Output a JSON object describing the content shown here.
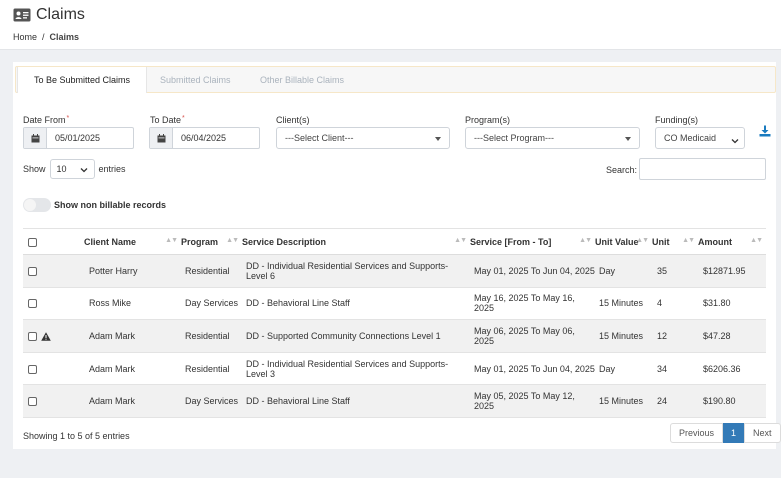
{
  "page": {
    "title": "Claims",
    "title_icon": "id-card-icon"
  },
  "breadcrumb": {
    "home": "Home",
    "separator": "/",
    "current": "Claims"
  },
  "tabs": [
    {
      "label": "To Be Submitted Claims",
      "active": true
    },
    {
      "label": "Submitted Claims",
      "active": false
    },
    {
      "label": "Other Billable Claims",
      "active": false
    }
  ],
  "filters": {
    "date_from": {
      "label": "Date From",
      "required_mark": "*",
      "value": "05/01/2025"
    },
    "to_date": {
      "label": "To Date",
      "required_mark": "*",
      "value": "06/04/2025"
    },
    "clients": {
      "label": "Client(s)",
      "value": "---Select Client---"
    },
    "programs": {
      "label": "Program(s)",
      "value": "---Select Program---"
    },
    "funding": {
      "label": "Funding(s)",
      "value": "CO Medicaid"
    },
    "download_icon": "download-icon"
  },
  "table_controls": {
    "show_label": "Show",
    "entries_value": "10",
    "entries_label": "entries",
    "search_label": "Search:",
    "search_value": "",
    "toggle_label": "Show non billable records",
    "toggle_on": false
  },
  "columns": [
    "Client Name",
    "Program",
    "Service Description",
    "Service [From - To]",
    "Unit Value",
    "Unit",
    "Amount"
  ],
  "rows": [
    {
      "client": "Potter Harry",
      "program": "Residential",
      "description": "DD - Individual Residential Services and Supports- Level 6",
      "service": "May 01, 2025 To Jun 04, 2025",
      "unit_value": "Day",
      "unit": "35",
      "amount": "$12871.95",
      "warning": false
    },
    {
      "client": "Ross Mike",
      "program": "Day Services",
      "description": "DD - Behavioral Line Staff",
      "service": "May 16, 2025 To May 16, 2025",
      "unit_value": "15 Minutes",
      "unit": "4",
      "amount": "$31.80",
      "warning": false
    },
    {
      "client": "Adam Mark",
      "program": "Residential",
      "description": "DD - Supported Community Connections Level 1",
      "service": "May 06, 2025 To May 06, 2025",
      "unit_value": "15 Minutes",
      "unit": "12",
      "amount": "$47.28",
      "warning": true
    },
    {
      "client": "Adam Mark",
      "program": "Residential",
      "description": "DD - Individual Residential Services and Supports- Level 3",
      "service": "May 01, 2025 To Jun 04, 2025",
      "unit_value": "Day",
      "unit": "34",
      "amount": "$6206.36",
      "warning": false
    },
    {
      "client": "Adam Mark",
      "program": "Day Services",
      "description": "DD - Behavioral Line Staff",
      "service": "May 05, 2025 To May 12, 2025",
      "unit_value": "15 Minutes",
      "unit": "24",
      "amount": "$190.80",
      "warning": false
    }
  ],
  "footer": {
    "info": "Showing 1 to 5 of 5 entries",
    "previous": "Previous",
    "current_page": "1",
    "next": "Next"
  },
  "colors": {
    "accent": "#337ab7",
    "download": "#1a7bbf",
    "required": "#d9534f",
    "tab_border": "#f6e7c8"
  }
}
